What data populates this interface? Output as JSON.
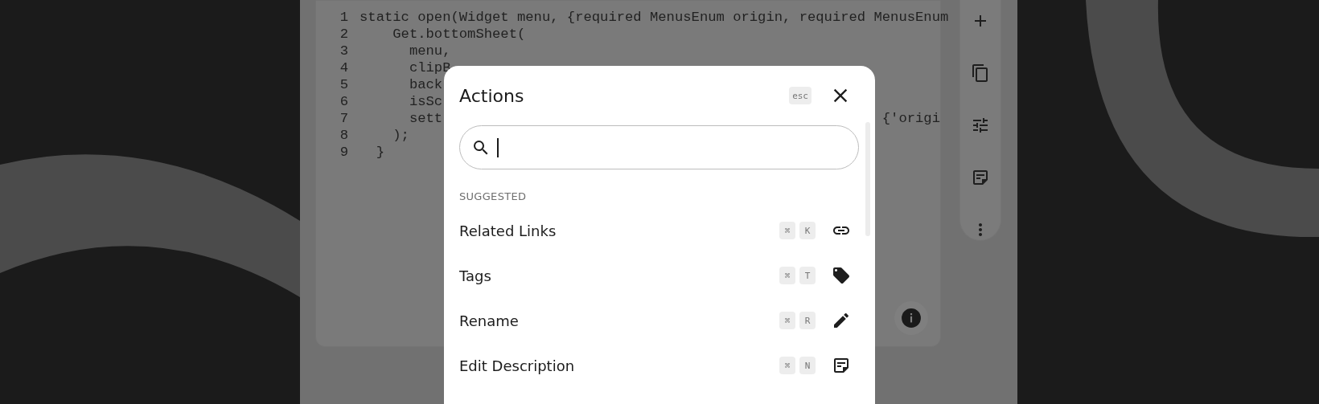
{
  "editor": {
    "lines": [
      {
        "number": "1",
        "text": "static open(Widget menu, {required MenusEnum origin, required MenusEnum"
      },
      {
        "number": "2",
        "text": "    Get.bottomSheet("
      },
      {
        "number": "3",
        "text": "      menu,"
      },
      {
        "number": "4",
        "text": "      clipB"
      },
      {
        "number": "5",
        "text": "      back"
      },
      {
        "number": "6",
        "text": "      isSc"
      },
      {
        "number": "7",
        "text": "      sett",
        "tail": "{'origi"
      },
      {
        "number": "8",
        "text": "    );"
      },
      {
        "number": "9",
        "text": "  }"
      }
    ]
  },
  "dialog": {
    "title": "Actions",
    "esc_key": "esc",
    "section": "SUGGESTED",
    "items": [
      {
        "label": "Related Links",
        "keys": [
          "⌘",
          "K"
        ],
        "kind": "link"
      },
      {
        "label": "Tags",
        "keys": [
          "⌘",
          "T"
        ],
        "kind": "tag"
      },
      {
        "label": "Rename",
        "keys": [
          "⌘",
          "R"
        ],
        "kind": "rename"
      },
      {
        "label": "Edit Description",
        "keys": [
          "⌘",
          "N"
        ],
        "kind": "description"
      }
    ]
  }
}
